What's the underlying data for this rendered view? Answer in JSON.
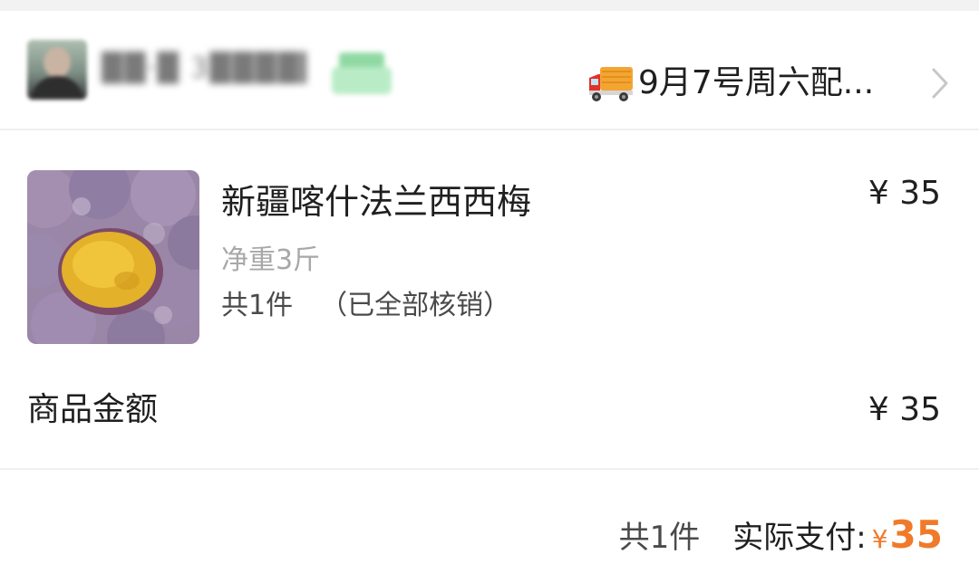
{
  "header": {
    "store_name": "██·█ 3███████",
    "delivery_text": "9月7号周六配...",
    "icons": {
      "avatar": "avatar",
      "badge": "store-badge-icon",
      "delivery": "truck-icon",
      "chevron": "chevron-right-icon"
    }
  },
  "product": {
    "title": "新疆喀什法兰西西梅",
    "price": "¥ 35",
    "spec": "净重3斤",
    "qty": "共1件",
    "status": "（已全部核销）"
  },
  "summary": {
    "amount_label": "商品金额",
    "amount_value": "¥ 35"
  },
  "footer": {
    "count": "共1件",
    "paid_label": "实际支付:",
    "currency": "¥",
    "paid_amount": "35"
  },
  "colors": {
    "accent": "#f07a2a",
    "muted_text": "#a8a8a8",
    "divider": "#f0f0f0"
  }
}
